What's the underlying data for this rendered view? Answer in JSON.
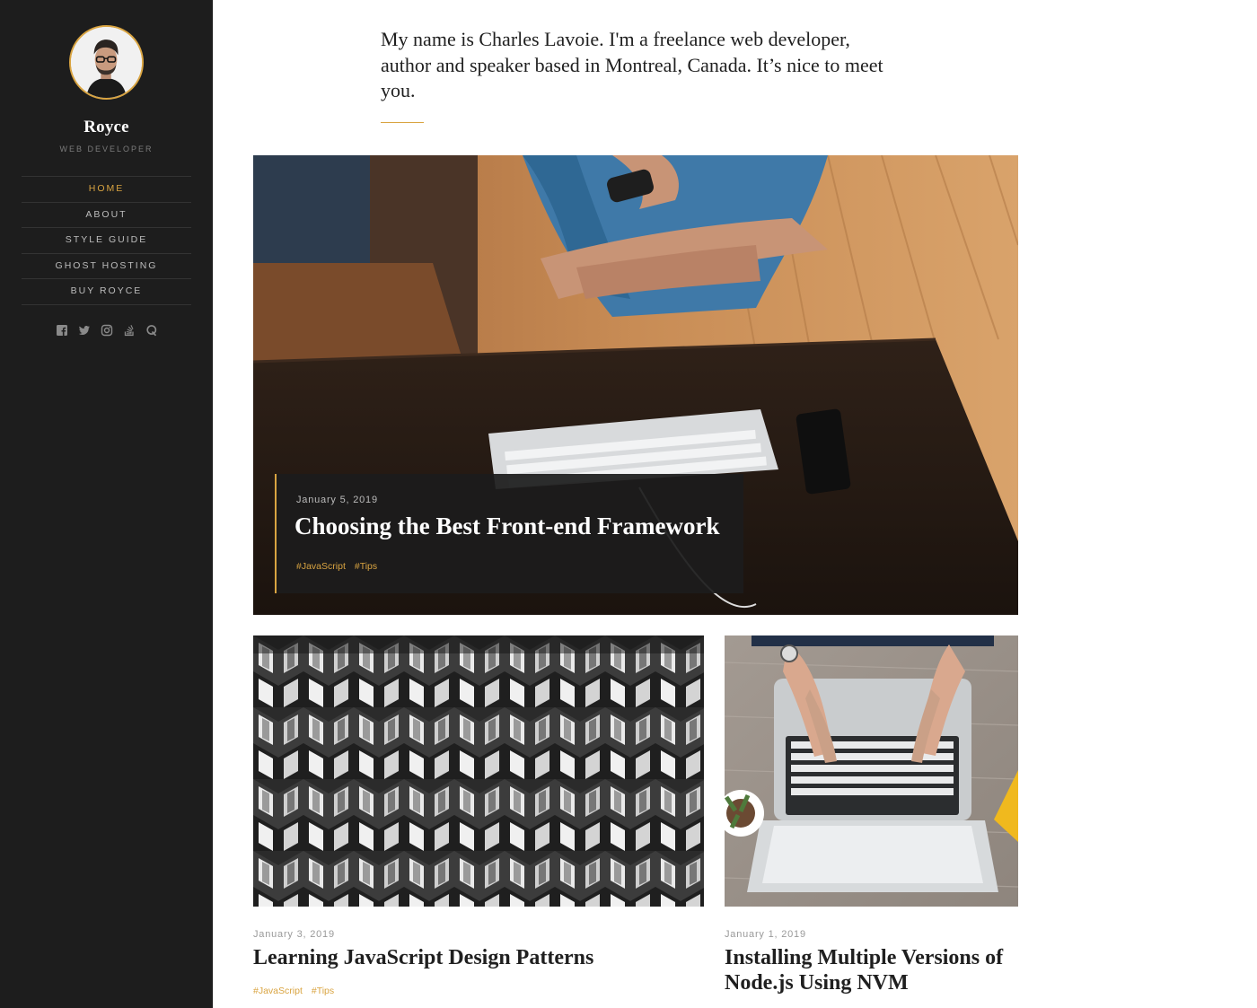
{
  "sidebar": {
    "site_name": "Royce",
    "site_role": "WEB DEVELOPER",
    "nav": [
      {
        "label": "HOME",
        "active": true
      },
      {
        "label": "ABOUT",
        "active": false
      },
      {
        "label": "STYLE GUIDE",
        "active": false
      },
      {
        "label": "GHOST HOSTING",
        "active": false
      },
      {
        "label": "BUY ROYCE",
        "active": false
      }
    ],
    "social_icons": [
      "facebook-icon",
      "twitter-icon",
      "instagram-icon",
      "stackoverflow-icon",
      "quora-icon"
    ]
  },
  "intro": {
    "text": "My name is Charles Lavoie. I'm a freelance web developer, author and speaker based in Montreal, Canada. It’s nice to meet you."
  },
  "featured_post": {
    "date": "January 5, 2019",
    "title": "Choosing the Best Front-end Framework",
    "tags": [
      "#JavaScript",
      "#Tips"
    ]
  },
  "posts": [
    {
      "date": "January 3, 2019",
      "title": "Learning JavaScript Design Patterns",
      "tags": [
        "#JavaScript",
        "#Tips"
      ]
    },
    {
      "date": "January 1, 2019",
      "title": "Installing Multiple Versions of Node.js Using NVM",
      "tags": []
    }
  ],
  "colors": {
    "accent": "#d9a441",
    "sidebar_bg": "#1d1d1d",
    "text": "#1f1f1f"
  }
}
